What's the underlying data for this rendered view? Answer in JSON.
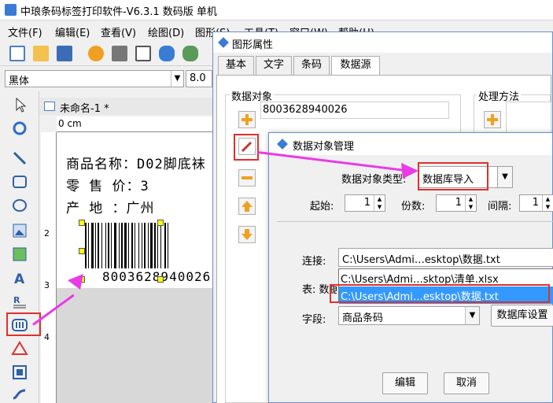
{
  "app": {
    "title": "中琅条码标签打印软件-V6.3.1 数码版 单机",
    "menu": [
      "文件(F)",
      "编辑(E)",
      "查看(V)",
      "绘图(D)",
      "图形(S)",
      "工具(T)",
      "窗口(W)",
      "帮助(H)"
    ],
    "font_name": "黑体",
    "font_size": "8.0",
    "doc_tab": "未命名-1 *",
    "ruler_top": "0 cm",
    "ruler_left": [
      "2",
      "3",
      "4"
    ],
    "label_lines": [
      "商品名称：D02脚底袜",
      "零 售 价：3",
      "产    地  ：广州"
    ],
    "barcode_text": "8003628940026"
  },
  "prop_dialog": {
    "title": "图形属性",
    "tabs": [
      "基本",
      "文字",
      "条码",
      "数据源"
    ],
    "data_objects_label": "数据对象",
    "process_method_label": "处理方法",
    "data_object_item": "8003628940026"
  },
  "db_dialog": {
    "title": "数据对象管理",
    "type_label": "数据对象类型:",
    "type_value": "数据库导入",
    "start_label": "起始:",
    "start_value": "1",
    "copies_label": "份数:",
    "copies_value": "1",
    "interval_label": "间隔:",
    "interval_value": "1",
    "conn_label": "连接:",
    "conn_value": "C:\\Users\\Admi…esktop\\数据.txt",
    "conn_options": [
      "C:\\Users\\Admi…sktop\\清单.xlsx",
      "C:\\Users\\Admi…esktop\\数据.txt"
    ],
    "table_label": "表: 数据",
    "field_label": "字段:",
    "field_value": "商品条码",
    "db_settings_button": "数据库设置",
    "edit_button": "编辑",
    "cancel_button": "取消"
  },
  "colors": {
    "highlight_red": "#e0302c",
    "arrow_magenta": "#e93be6",
    "selection_blue": "#3399ff",
    "handle_yellow": "#ffff00"
  }
}
